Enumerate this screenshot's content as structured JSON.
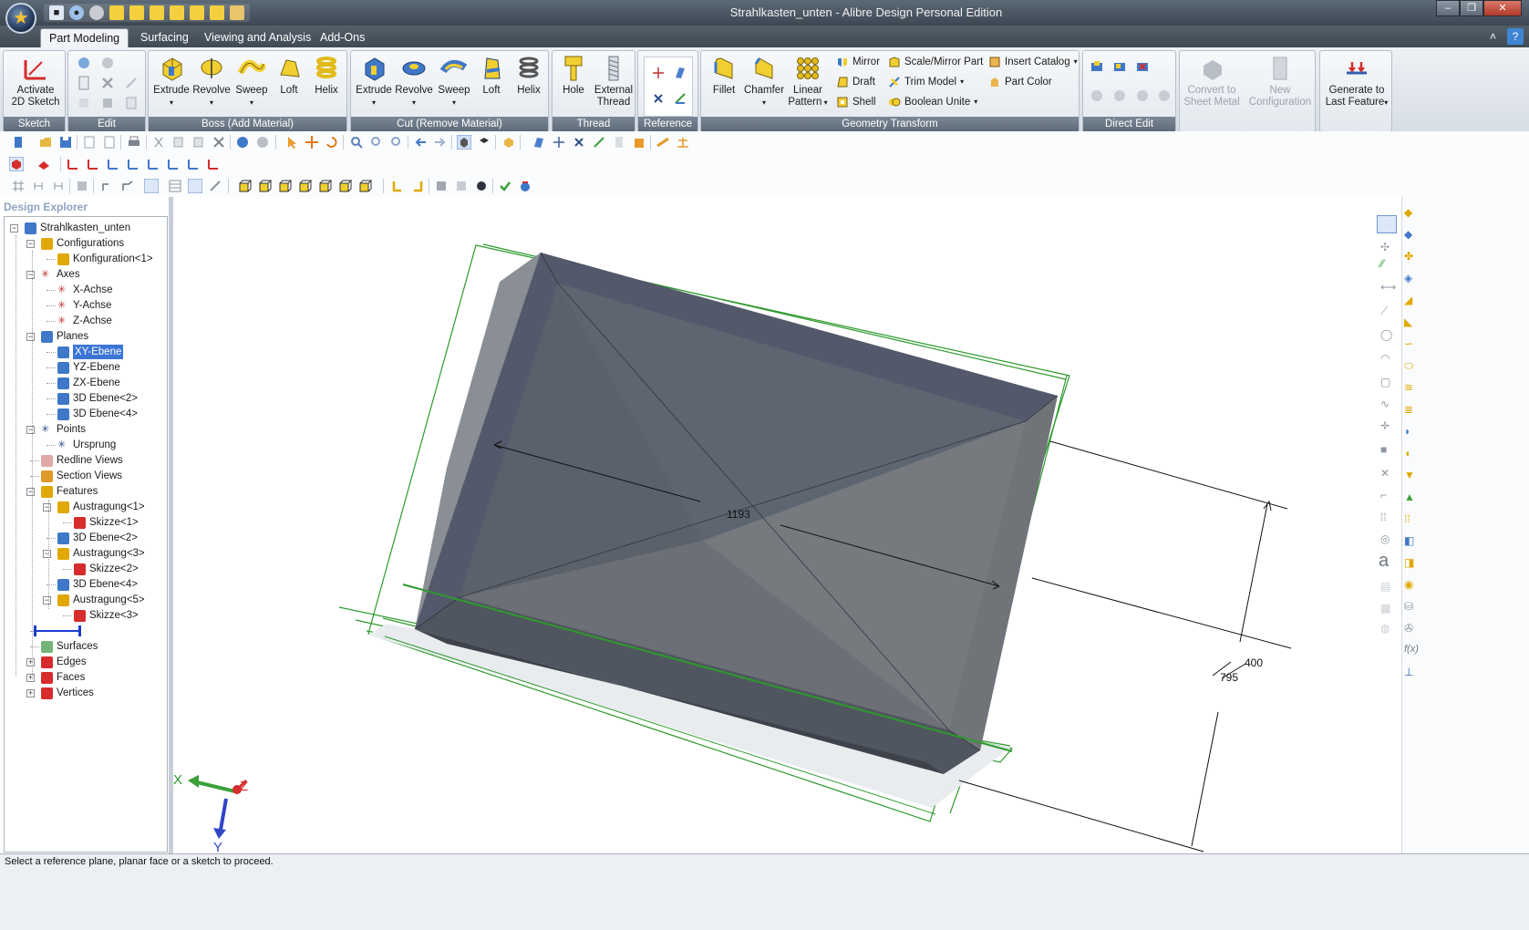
{
  "window": {
    "title": "Strahlkasten_unten - Alibre Design Personal Edition"
  },
  "ribbon_tabs": [
    {
      "label": "Part Modeling"
    },
    {
      "label": "Surfacing"
    },
    {
      "label": "Viewing and Analysis"
    },
    {
      "label": "Add-Ons"
    }
  ],
  "ribbon": {
    "sketch": {
      "label": "Sketch",
      "activate": "Activate\n2D Sketch"
    },
    "edit": {
      "label": "Edit"
    },
    "boss": {
      "label": "Boss (Add Material)",
      "buttons": [
        "Extrude",
        "Revolve",
        "Sweep",
        "Loft",
        "Helix"
      ]
    },
    "cut": {
      "label": "Cut (Remove Material)",
      "buttons": [
        "Extrude",
        "Revolve",
        "Sweep",
        "Loft",
        "Helix"
      ]
    },
    "thread": {
      "label": "Thread",
      "hole": "Hole",
      "external": "External\nThread"
    },
    "reference": {
      "label": "Reference"
    },
    "geometry": {
      "label": "Geometry Transform",
      "fillet": "Fillet",
      "chamfer": "Chamfer",
      "linear_pattern": "Linear\nPattern",
      "mirror": "Mirror",
      "draft": "Draft",
      "shell": "Shell",
      "scale_mirror": "Scale/Mirror Part",
      "trim_model": "Trim Model",
      "boolean_unite": "Boolean Unite",
      "insert_catalog": "Insert Catalog",
      "part_color": "Part Color"
    },
    "direct_edit": {
      "label": "Direct Edit"
    },
    "misc": {
      "convert": "Convert to\nSheet Metal",
      "new_config": "New\nConfiguration",
      "generate": "Generate to\nLast Feature"
    }
  },
  "explorer": {
    "title": "Design Explorer",
    "items": [
      {
        "label": "Strahlkasten_unten",
        "level": 0,
        "icon": "part-icon",
        "exp": "-"
      },
      {
        "label": "Configurations",
        "level": 1,
        "icon": "configurations-icon",
        "exp": "-"
      },
      {
        "label": "Konfiguration<1>",
        "level": 2,
        "icon": "configuration-icon"
      },
      {
        "label": "Axes",
        "level": 1,
        "icon": "axes-icon",
        "exp": "-"
      },
      {
        "label": "X-Achse",
        "level": 2,
        "icon": "axis-icon"
      },
      {
        "label": "Y-Achse",
        "level": 2,
        "icon": "axis-icon"
      },
      {
        "label": "Z-Achse",
        "level": 2,
        "icon": "axis-icon"
      },
      {
        "label": "Planes",
        "level": 1,
        "icon": "planes-icon",
        "exp": "-"
      },
      {
        "label": "XY-Ebene",
        "level": 2,
        "icon": "plane-icon",
        "selected": true
      },
      {
        "label": "YZ-Ebene",
        "level": 2,
        "icon": "plane-icon"
      },
      {
        "label": "ZX-Ebene",
        "level": 2,
        "icon": "plane-icon"
      },
      {
        "label": "3D Ebene<2>",
        "level": 2,
        "icon": "plane-icon"
      },
      {
        "label": "3D Ebene<4>",
        "level": 2,
        "icon": "plane-icon"
      },
      {
        "label": "Points",
        "level": 1,
        "icon": "points-icon",
        "exp": "-"
      },
      {
        "label": "Ursprung",
        "level": 2,
        "icon": "point-icon"
      },
      {
        "label": "Redline Views",
        "level": 1,
        "icon": "redline-icon"
      },
      {
        "label": "Section Views",
        "level": 1,
        "icon": "section-icon"
      },
      {
        "label": "Features",
        "level": 1,
        "icon": "features-icon",
        "exp": "-"
      },
      {
        "label": "Austragung<1>",
        "level": 2,
        "icon": "extrude-icon",
        "exp": "-"
      },
      {
        "label": "Skizze<1>",
        "level": 3,
        "icon": "sketch-icon"
      },
      {
        "label": "3D Ebene<2>",
        "level": 2,
        "icon": "plane-icon"
      },
      {
        "label": "Austragung<3>",
        "level": 2,
        "icon": "extrude-icon",
        "exp": "-"
      },
      {
        "label": "Skizze<2>",
        "level": 3,
        "icon": "sketch-icon"
      },
      {
        "label": "3D Ebene<4>",
        "level": 2,
        "icon": "plane-icon"
      },
      {
        "label": "Austragung<5>",
        "level": 2,
        "icon": "extrude-icon",
        "exp": "-"
      },
      {
        "label": "Skizze<3>",
        "level": 3,
        "icon": "sketch-icon"
      },
      {
        "label": "",
        "level": 1,
        "icon": "rollback-bar-icon"
      },
      {
        "label": "Surfaces",
        "level": 1,
        "icon": "surfaces-icon"
      },
      {
        "label": "Edges",
        "level": 1,
        "icon": "edges-icon",
        "exp": "+"
      },
      {
        "label": "Faces",
        "level": 1,
        "icon": "faces-icon",
        "exp": "+"
      },
      {
        "label": "Vertices",
        "level": 1,
        "icon": "vertices-icon",
        "exp": "+"
      }
    ]
  },
  "viewport": {
    "dimensions": [
      "1193",
      "400",
      "795"
    ],
    "triad": {
      "x": "X",
      "y": "Y",
      "z": "Z"
    }
  },
  "status": {
    "text": "Select a reference plane, planar face or a sketch to proceed."
  },
  "colors": {
    "accent": "#3c75d6",
    "ribbon_label": "#6b7786",
    "sketch_green": "#2d9a2d",
    "part_gray": "#5f6670"
  }
}
